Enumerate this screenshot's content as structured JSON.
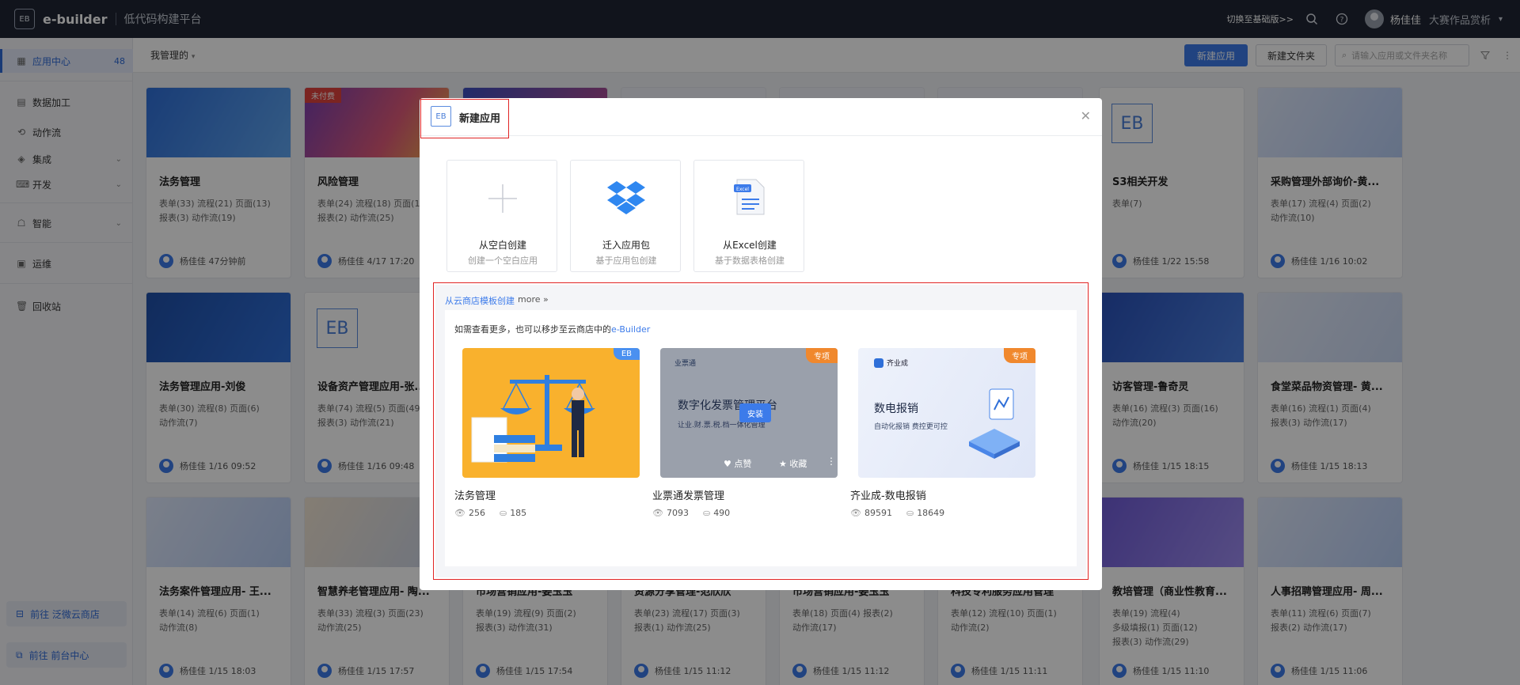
{
  "header": {
    "logo": "EB",
    "brand": "e-builder",
    "subtitle": "低代码构建平台",
    "switch_link": "切换至基础版>>",
    "user": "杨佳佳",
    "org": "大赛作品赏析",
    "icons": [
      "search-icon",
      "help-icon",
      "avatar",
      "chevron-down-icon"
    ]
  },
  "sidebar": {
    "items": [
      {
        "label": "应用中心",
        "count": "48",
        "icon": "grid-icon"
      },
      {
        "label": "数据加工",
        "icon": "table-icon"
      },
      {
        "label": "动作流",
        "icon": "flow-icon"
      },
      {
        "label": "集成",
        "icon": "layers-icon"
      },
      {
        "label": "开发",
        "icon": "code-icon"
      },
      {
        "label": "智能",
        "icon": "robot-icon"
      },
      {
        "label": "运维",
        "icon": "monitor-icon"
      },
      {
        "label": "回收站",
        "icon": "trash-icon"
      }
    ],
    "store_btn": "前往 泛微云商店",
    "front_btn": "前往 前台中心"
  },
  "toolbar": {
    "filter": "我管理的",
    "new_app": "新建应用",
    "new_folder": "新建文件夹",
    "search_placeholder": "请输入应用或文件夹名称"
  },
  "cards": [
    {
      "title": "法务管理",
      "line1": "表单(33) 流程(21) 页面(13)",
      "line2": "报表(3) 动作流(19)",
      "user": "杨佳佳",
      "time": "47分钟前"
    },
    {
      "title": "风险管理",
      "badge": "未付费",
      "line1": "表单(24) 流程(18) 页面(1",
      "line2": "报表(2) 动作流(25)",
      "user": "杨佳佳",
      "time": "4/17 17:20"
    },
    {
      "title": "S3相关开发",
      "line1": "表单(7)",
      "line2": "",
      "user": "杨佳佳",
      "time": "1/22 15:58"
    },
    {
      "title": "采购管理外部询价-黄...",
      "line1": "表单(17) 流程(4) 页面(2)",
      "line2": "动作流(10)",
      "user": "杨佳佳",
      "time": "1/16 10:02"
    },
    {
      "title": "法务管理应用-刘俊",
      "line1": "表单(30) 流程(8) 页面(6)",
      "line2": "动作流(7)",
      "user": "杨佳佳",
      "time": "1/16 09:52"
    },
    {
      "title": "设备资产管理应用-张...",
      "line1": "表单(74) 流程(5) 页面(49",
      "line2": "报表(3) 动作流(21)",
      "user": "杨佳佳",
      "time": "1/16 09:48"
    },
    {
      "title": "访客管理-鲁奇灵",
      "line1": "表单(16) 流程(3) 页面(16)",
      "line2": "动作流(20)",
      "user": "杨佳佳",
      "time": "1/15 18:15"
    },
    {
      "title": "食堂菜品物资管理- 黄...",
      "line1": "表单(16) 流程(1) 页面(4)",
      "line2": "报表(3) 动作流(17)",
      "user": "杨佳佳",
      "time": "1/15 18:13"
    },
    {
      "title": "法务案件管理应用- 王...",
      "line1": "表单(14) 流程(6) 页面(1)",
      "line2": "动作流(8)",
      "user": "杨佳佳",
      "time": "1/15 18:03"
    },
    {
      "title": "智慧养老管理应用- 陶...",
      "line1": "表单(33) 流程(3) 页面(23)",
      "line2": "动作流(25)",
      "user": "杨佳佳",
      "time": "1/15 17:57"
    },
    {
      "title": "市场营销应用-姜玉玉",
      "line1": "表单(19) 流程(9) 页面(2)",
      "line2": "报表(3) 动作流(31)",
      "user": "杨佳佳",
      "time": "1/15 17:54"
    },
    {
      "title": "资源分享管理-范欣欣",
      "line1": "表单(23) 流程(17) 页面(3)",
      "line2": "报表(1) 动作流(25)",
      "user": "杨佳佳",
      "time": "1/15 11:12"
    },
    {
      "title": "市场营销应用-姜玉玉",
      "line1": "表单(18) 页面(4) 报表(2)",
      "line2": "动作流(17)",
      "user": "杨佳佳",
      "time": "1/15 11:12"
    },
    {
      "title": "科技专利服务应用管理",
      "line1": "表单(12) 流程(10) 页面(1)",
      "line2": "动作流(2)",
      "user": "杨佳佳",
      "time": "1/15 11:11"
    },
    {
      "title": "教培管理（商业性教育...",
      "line1": "表单(19) 流程(4)",
      "line2": "多级填报(1) 页面(12)",
      "line3": "报表(3) 动作流(29)",
      "user": "杨佳佳",
      "time": "1/15 11:10"
    },
    {
      "title": "人事招聘管理应用- 周...",
      "line1": "表单(11) 流程(6) 页面(7)",
      "line2": "报表(2) 动作流(17)",
      "user": "杨佳佳",
      "time": "1/15 11:06"
    }
  ],
  "modal": {
    "logo": "EB",
    "title": "新建应用",
    "options": [
      {
        "title": "从空白创建",
        "sub": "创建一个空白应用",
        "icon": "plus-icon"
      },
      {
        "title": "迁入应用包",
        "sub": "基于应用包创建",
        "icon": "package-icon"
      },
      {
        "title": "从Excel创建",
        "sub": "基于数据表格创建",
        "icon": "excel-icon"
      }
    ],
    "store_title": "从云商店模板创建",
    "store_more": "more",
    "store_tip_prefix": "如需查看更多，也可以移步至云商店中的",
    "store_tip_link": "e-Builder",
    "templates": [
      {
        "name": "法务管理",
        "views": "256",
        "downloads": "185",
        "tag": "EB",
        "tag_color": "#4a90f0"
      },
      {
        "name": "业票通发票管理",
        "views": "7093",
        "downloads": "490",
        "tag": "专项",
        "tag_color": "#f0882d",
        "logo_text": "业票通",
        "headline": "数字化发票管理平台",
        "slogan": "让业.财.票.税.档一体化管理",
        "install": "安装",
        "like": "点赞",
        "fav": "收藏"
      },
      {
        "name": "齐业成-数电报销",
        "views": "89591",
        "downloads": "18649",
        "tag": "专项",
        "tag_color": "#f0882d",
        "logo_text": "齐业成",
        "headline": "数电报销",
        "slogan": "自动化报销  费控更可控"
      }
    ]
  },
  "chart_data": null
}
